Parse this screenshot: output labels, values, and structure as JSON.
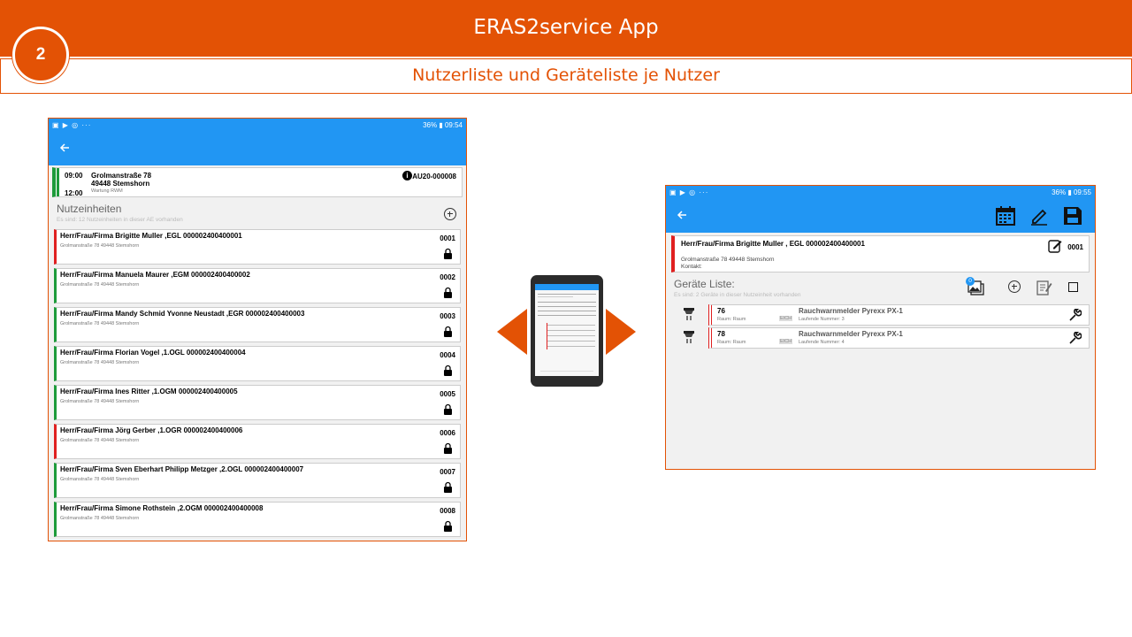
{
  "slide": {
    "app_title": "ERAS2service App",
    "subtitle": "Nutzerliste und Geräteliste je Nutzer",
    "step_number": "2",
    "brand_color": "#e35205",
    "app_blue": "#2196f3"
  },
  "left_screen": {
    "status_icons_left": "▣ ▶ ◎ ···",
    "status_right": "36% ▮ 09:54",
    "back_icon": "arrow-left-icon",
    "order": {
      "time_start": "09:00",
      "time_end": "12:00",
      "street": "Grolmanstraße 78",
      "city": "49448 Stemshorn",
      "service": "Wartung RWM",
      "order_number": "AU20-000008"
    },
    "section_title": "Nutzeinheiten",
    "section_info": "Es sind: 12 Nutzeinheiten in dieser AE vorhanden",
    "units": [
      {
        "name": "Herr/Frau/Firma Brigitte Muller ,EGL 000002400400001",
        "address": "Grolmanstraße 78 49448 Stemshorn",
        "number": "0001",
        "status": "red"
      },
      {
        "name": "Herr/Frau/Firma Manuela Maurer ,EGM 000002400400002",
        "address": "Grolmanstraße 78 49448 Stemshorn",
        "number": "0002",
        "status": "green"
      },
      {
        "name": "Herr/Frau/Firma Mandy Schmid Yvonne Neustadt ,EGR 000002400400003",
        "address": "Grolmanstraße 78 49448 Stemshorn",
        "number": "0003",
        "status": "green"
      },
      {
        "name": "Herr/Frau/Firma Florian Vogel ,1.OGL 000002400400004",
        "address": "Grolmanstraße 78 49448 Stemshorn",
        "number": "0004",
        "status": "green"
      },
      {
        "name": "Herr/Frau/Firma Ines Ritter ,1.OGM 000002400400005",
        "address": "Grolmanstraße 78 49448 Stemshorn",
        "number": "0005",
        "status": "green"
      },
      {
        "name": "Herr/Frau/Firma Jörg Gerber ,1.OGR 000002400400006",
        "address": "Grolmanstraße 78 49448 Stemshorn",
        "number": "0006",
        "status": "red"
      },
      {
        "name": "Herr/Frau/Firma Sven Eberhart Philipp Metzger ,2.OGL 000002400400007",
        "address": "Grolmanstraße 78 49448 Stemshorn",
        "number": "0007",
        "status": "green"
      },
      {
        "name": "Herr/Frau/Firma Simone Rothstein ,2.OGM 000002400400008",
        "address": "Grolmanstraße 78 49448 Stemshorn",
        "number": "0008",
        "status": "green"
      }
    ]
  },
  "right_screen": {
    "status_icons_left": "▣ ▶ ◎ ···",
    "status_right": "36% ▮ 09:55",
    "nutzeinheit": {
      "name": "Herr/Frau/Firma Brigitte Muller , EGL 000002400400001",
      "address": "Grolmanstraße 78 49448 Stemshorn",
      "contact_label": "Kontakt:",
      "number": "0001"
    },
    "section_title": "Geräte Liste:",
    "section_info": "Es sind: 2 Geräte in dieser Nutzeinheit vorhanden",
    "photo_badge": "0",
    "devices": [
      {
        "number": "76",
        "room": "Raum: Raum",
        "eich": "EICH",
        "type": "Rauchwarnmelder Pyrexx PX-1",
        "sequence": "Laufende Nummer: 3"
      },
      {
        "number": "78",
        "room": "Raum: Raum",
        "eich": "EICH",
        "type": "Rauchwarnmelder Pyrexx PX-1",
        "sequence": "Laufende Nummer: 4"
      }
    ]
  }
}
